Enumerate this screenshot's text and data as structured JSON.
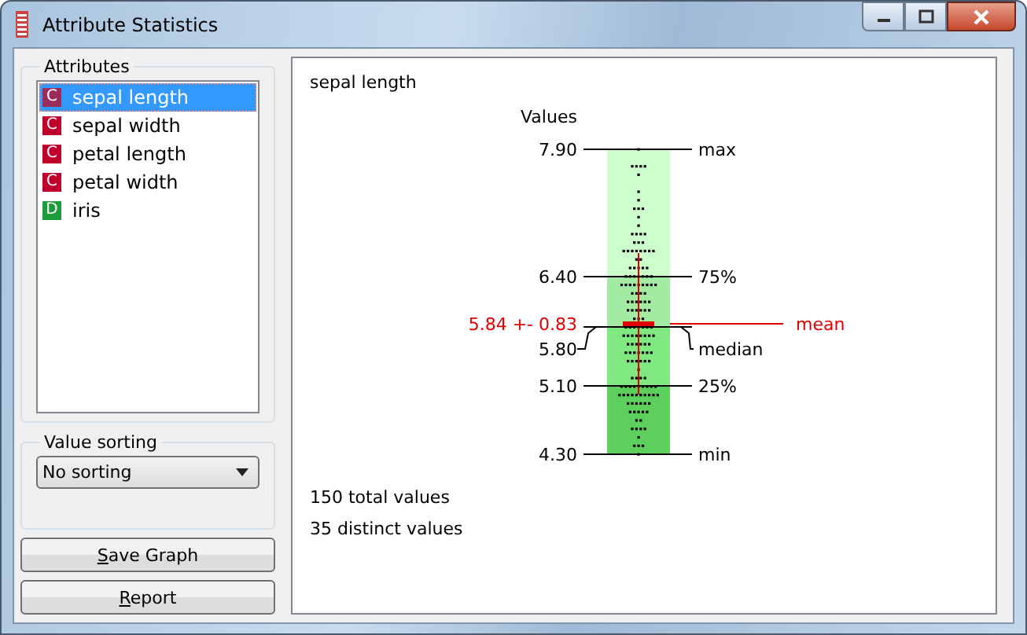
{
  "window": {
    "title": "Attribute Statistics"
  },
  "attributes": {
    "title": "Attributes",
    "items": [
      {
        "badge": "C",
        "color": "#9c2c5e",
        "name": "sepal length",
        "selected": true
      },
      {
        "badge": "C",
        "color": "#c0002a",
        "name": "sepal width",
        "selected": false
      },
      {
        "badge": "C",
        "color": "#c0002a",
        "name": "petal length",
        "selected": false
      },
      {
        "badge": "C",
        "color": "#c0002a",
        "name": "petal width",
        "selected": false
      },
      {
        "badge": "D",
        "color": "#1f9a3c",
        "name": "iris",
        "selected": false
      }
    ]
  },
  "value_sorting": {
    "title": "Value sorting",
    "value": "No sorting"
  },
  "buttons": [
    {
      "label": "Save Graph"
    },
    {
      "label": "Report"
    }
  ],
  "graph": {
    "title": "sepal length",
    "axis_title": "Values",
    "stats": [
      {
        "kind": "max",
        "value": "7.90",
        "label": "max"
      },
      {
        "kind": "q3",
        "value": "6.40",
        "label": "75%"
      },
      {
        "kind": "median",
        "value": "5.80",
        "label": "median"
      },
      {
        "kind": "q1",
        "value": "5.10",
        "label": "25%"
      },
      {
        "kind": "min",
        "value": "4.30",
        "label": "min"
      }
    ],
    "mean": {
      "value": "5.84 +- 0.83",
      "label": "mean"
    },
    "footer": [
      "150 total values",
      "35 distinct values"
    ]
  }
}
